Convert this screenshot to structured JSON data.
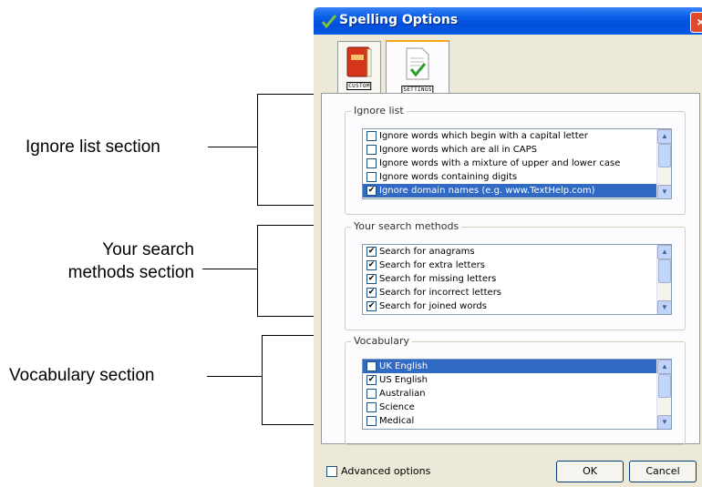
{
  "annotations": {
    "ignore_list": "Ignore list section",
    "search_methods": "Your search\nmethods section",
    "vocabulary": "Vocabulary section"
  },
  "window": {
    "title": "Spelling Options",
    "close_label": "×"
  },
  "tabs": [
    {
      "label": "CUSTOM",
      "icon": "book-icon",
      "selected": false
    },
    {
      "label": "SETTINGS",
      "icon": "settings-document-icon",
      "selected": true
    }
  ],
  "ignore_list": {
    "label": "Ignore list",
    "items": [
      {
        "text": "Ignore words which begin with a capital letter",
        "checked": false
      },
      {
        "text": "Ignore words which are all in CAPS",
        "checked": false
      },
      {
        "text": "Ignore words with a mixture of upper and lower case",
        "checked": false
      },
      {
        "text": "Ignore words containing digits",
        "checked": false
      },
      {
        "text": "Ignore domain names (e.g. www.TextHelp.com)",
        "checked": true,
        "selected": true
      }
    ]
  },
  "search_methods": {
    "label": "Your search methods",
    "items": [
      {
        "text": "Search for anagrams",
        "checked": true
      },
      {
        "text": "Search for extra letters",
        "checked": true
      },
      {
        "text": "Search for missing letters",
        "checked": true
      },
      {
        "text": "Search for incorrect letters",
        "checked": true
      },
      {
        "text": "Search for joined words",
        "checked": true
      }
    ]
  },
  "vocabulary": {
    "label": "Vocabulary",
    "items": [
      {
        "text": "UK English",
        "checked": false,
        "selected": true
      },
      {
        "text": "US English",
        "checked": true
      },
      {
        "text": "Australian",
        "checked": false
      },
      {
        "text": "Science",
        "checked": false
      },
      {
        "text": "Medical",
        "checked": false
      }
    ]
  },
  "footer": {
    "advanced_label": "Advanced options",
    "advanced_checked": false,
    "ok_label": "OK",
    "cancel_label": "Cancel"
  },
  "colors": {
    "selection": "#316ac5",
    "titlebar": "#0050dc",
    "dialog_bg": "#ece9d8"
  }
}
